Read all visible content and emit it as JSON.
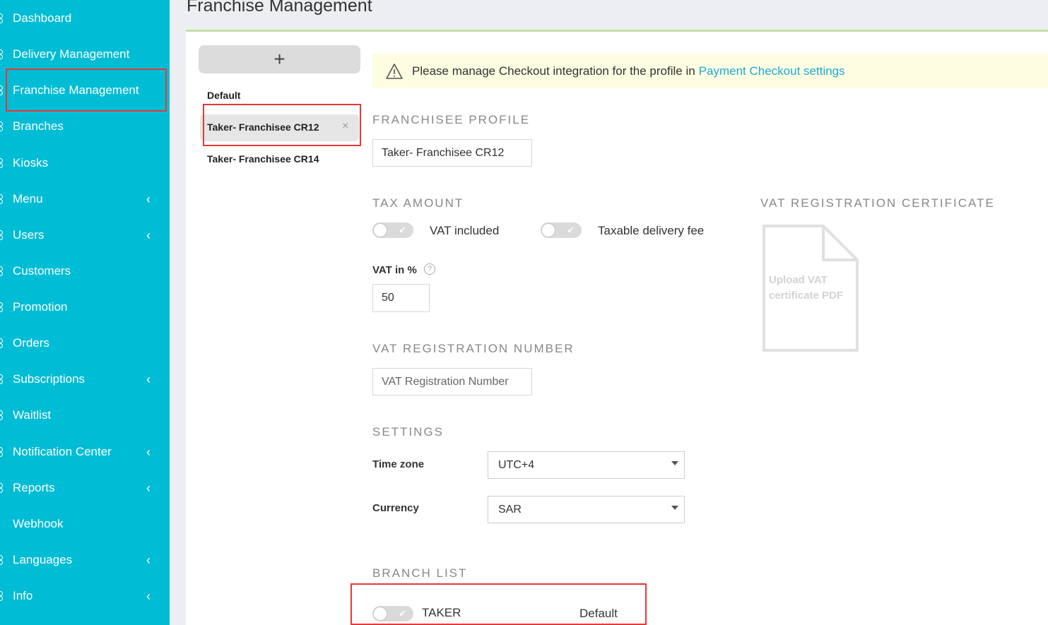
{
  "sidebar": {
    "items": [
      {
        "label": "Dashboard",
        "chevron": false
      },
      {
        "label": "Delivery Management",
        "chevron": false
      },
      {
        "label": "Franchise Management",
        "chevron": false
      },
      {
        "label": "Branches",
        "chevron": false
      },
      {
        "label": "Kiosks",
        "chevron": false
      },
      {
        "label": "Menu",
        "chevron": true
      },
      {
        "label": "Users",
        "chevron": true
      },
      {
        "label": "Customers",
        "chevron": false
      },
      {
        "label": "Promotion",
        "chevron": false
      },
      {
        "label": "Orders",
        "chevron": false
      },
      {
        "label": "Subscriptions",
        "chevron": true
      },
      {
        "label": "Waitlist",
        "chevron": false
      },
      {
        "label": "Notification Center",
        "chevron": true
      },
      {
        "label": "Reports",
        "chevron": true
      },
      {
        "label": "Webhook",
        "chevron": false
      },
      {
        "label": "Languages",
        "chevron": true
      },
      {
        "label": "Info",
        "chevron": true
      }
    ],
    "chevron_glyph": "‹",
    "color": "#00bcd4"
  },
  "page": {
    "title": "Franchise Management"
  },
  "profiles": {
    "add_glyph": "+",
    "items": [
      "Default",
      "Taker- Franchisee CR12",
      "Taker- Franchisee CR14"
    ],
    "close_glyph": "×"
  },
  "notice": {
    "text": "Please manage Checkout integration for the profile in",
    "link": "Payment Checkout settings"
  },
  "franchisee_profile": {
    "heading": "FRANCHISEE PROFILE",
    "value": "Taker- Franchisee CR12"
  },
  "tax": {
    "heading": "TAX AMOUNT",
    "vat_included_label": "VAT included",
    "taxable_fee_label": "Taxable delivery fee",
    "vat_percent_label": "VAT in %",
    "vat_percent_value": "50",
    "help_glyph": "?"
  },
  "vat_certificate": {
    "heading": "VAT REGISTRATION CERTIFICATE",
    "upload_text": "Upload VAT certificate PDF"
  },
  "vat_number": {
    "heading": "VAT REGISTRATION NUMBER",
    "placeholder": "VAT Registration Number"
  },
  "settings": {
    "heading": "SETTINGS",
    "timezone_label": "Time zone",
    "timezone_value": "UTC+4",
    "currency_label": "Currency",
    "currency_value": "SAR"
  },
  "branch_list": {
    "heading": "BRANCH LIST",
    "rows": [
      {
        "name": "TAKER",
        "profile": "Default"
      }
    ]
  },
  "toggle_check": "✔"
}
